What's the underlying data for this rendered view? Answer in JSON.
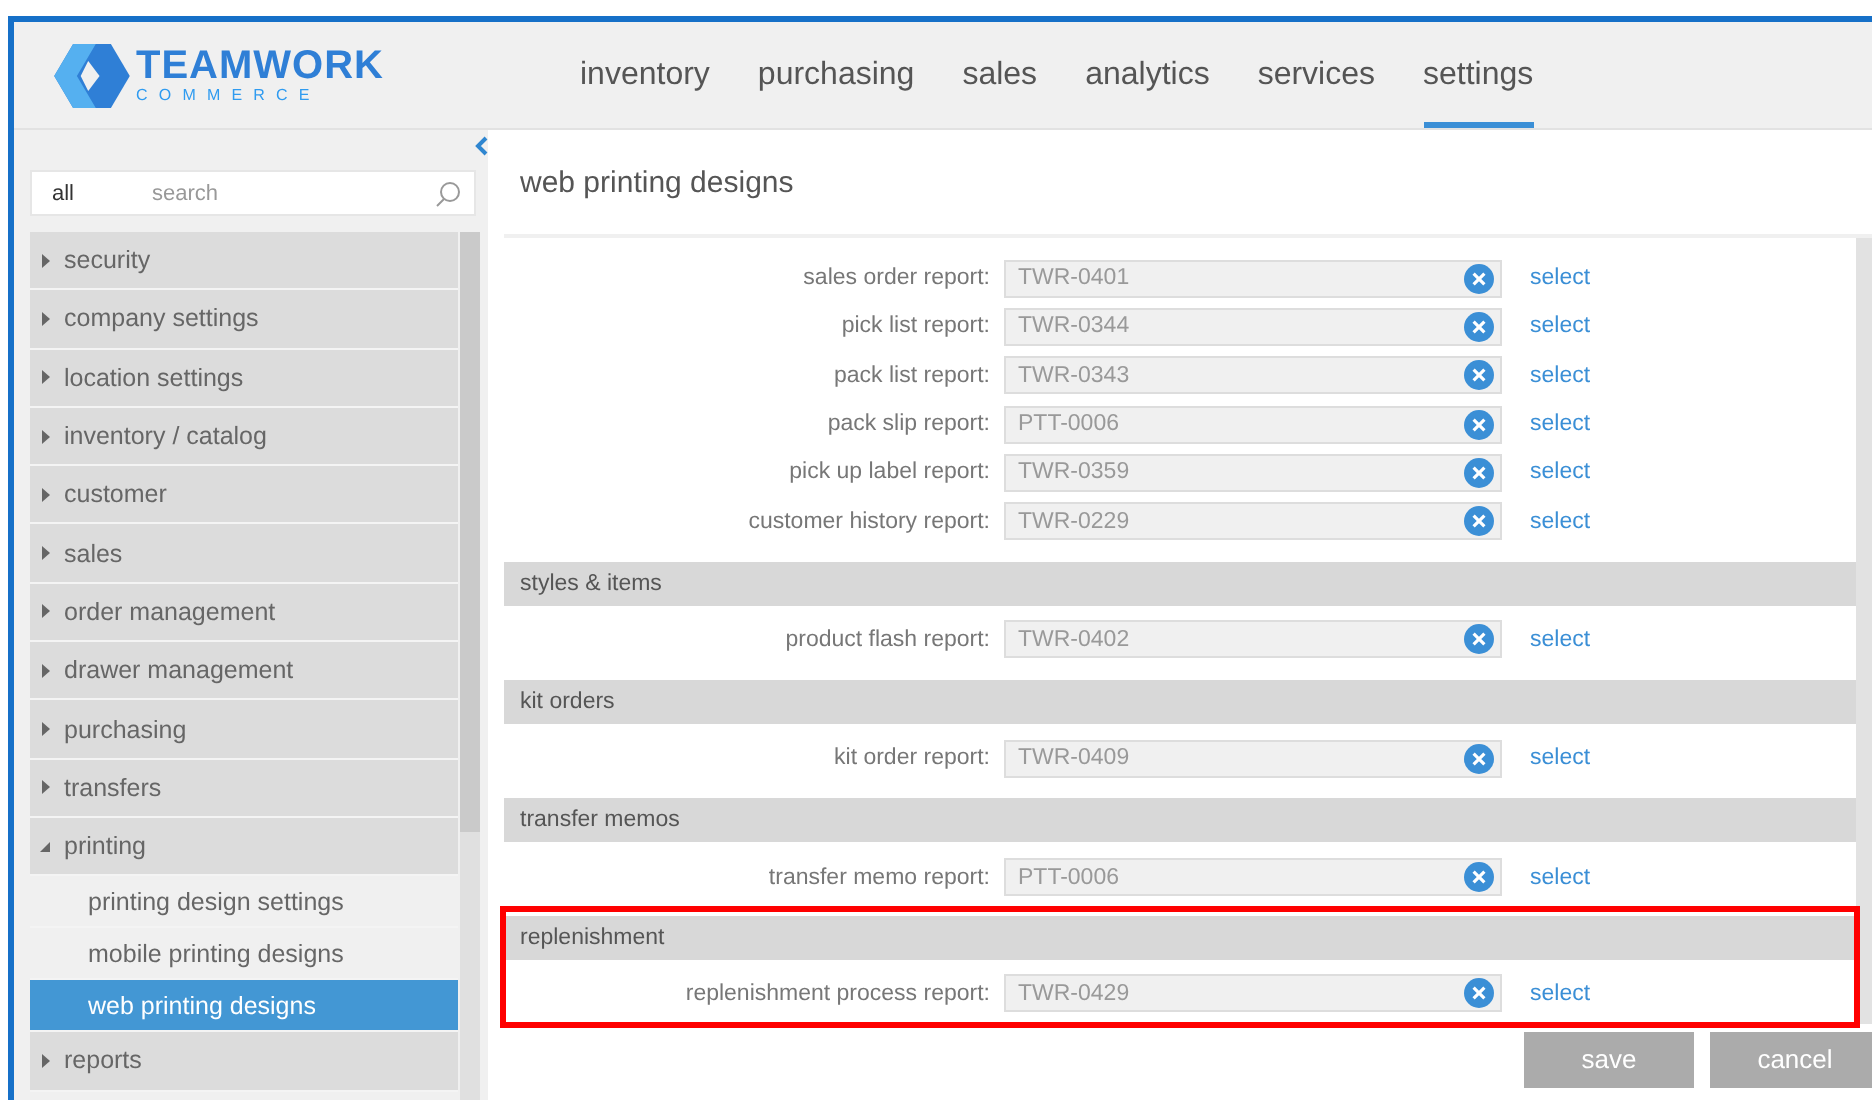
{
  "logo": {
    "name": "TEAMWORK",
    "tagline": "COMMERCE"
  },
  "nav": [
    {
      "label": "inventory",
      "selected": false
    },
    {
      "label": "purchasing",
      "selected": false
    },
    {
      "label": "sales",
      "selected": false
    },
    {
      "label": "analytics",
      "selected": false
    },
    {
      "label": "services",
      "selected": false
    },
    {
      "label": "settings",
      "selected": true
    }
  ],
  "sidebar": {
    "filter": "all",
    "search_placeholder": "search",
    "items": [
      {
        "label": "security",
        "expanded": false
      },
      {
        "label": "company settings",
        "expanded": false
      },
      {
        "label": "location settings",
        "expanded": false
      },
      {
        "label": "inventory / catalog",
        "expanded": false
      },
      {
        "label": "customer",
        "expanded": false
      },
      {
        "label": "sales",
        "expanded": false
      },
      {
        "label": "order management",
        "expanded": false
      },
      {
        "label": "drawer management",
        "expanded": false
      },
      {
        "label": "purchasing",
        "expanded": false
      },
      {
        "label": "transfers",
        "expanded": false
      },
      {
        "label": "printing",
        "expanded": true,
        "children": [
          {
            "label": "printing design settings",
            "selected": false
          },
          {
            "label": "mobile printing designs",
            "selected": false
          },
          {
            "label": "web printing designs",
            "selected": true
          }
        ]
      },
      {
        "label": "reports",
        "expanded": false
      }
    ]
  },
  "page_title": "web printing designs",
  "sections": [
    {
      "highlighted": false,
      "rows": [
        {
          "label": "sales order report:",
          "value": "TWR-0401",
          "action": "select"
        },
        {
          "label": "pick list report:",
          "value": "TWR-0344",
          "action": "select"
        },
        {
          "label": "pack list report:",
          "value": "TWR-0343",
          "action": "select"
        },
        {
          "label": "pack slip report:",
          "value": "PTT-0006",
          "action": "select"
        },
        {
          "label": "pick up label report:",
          "value": "TWR-0359",
          "action": "select"
        },
        {
          "label": "customer history report:",
          "value": "TWR-0229",
          "action": "select"
        }
      ]
    },
    {
      "title": "styles & items",
      "highlighted": false,
      "rows": [
        {
          "label": "product flash report:",
          "value": "TWR-0402",
          "action": "select"
        }
      ]
    },
    {
      "title": "kit orders",
      "highlighted": false,
      "rows": [
        {
          "label": "kit order report:",
          "value": "TWR-0409",
          "action": "select"
        }
      ]
    },
    {
      "title": "transfer memos",
      "highlighted": false,
      "rows": [
        {
          "label": "transfer memo report:",
          "value": "PTT-0006",
          "action": "select"
        }
      ]
    },
    {
      "title": "replenishment",
      "highlighted": true,
      "rows": [
        {
          "label": "replenishment process report:",
          "value": "TWR-0429",
          "action": "select"
        }
      ]
    }
  ],
  "buttons": [
    {
      "label": "save",
      "disabled": true
    },
    {
      "label": "cancel",
      "disabled": true
    }
  ]
}
